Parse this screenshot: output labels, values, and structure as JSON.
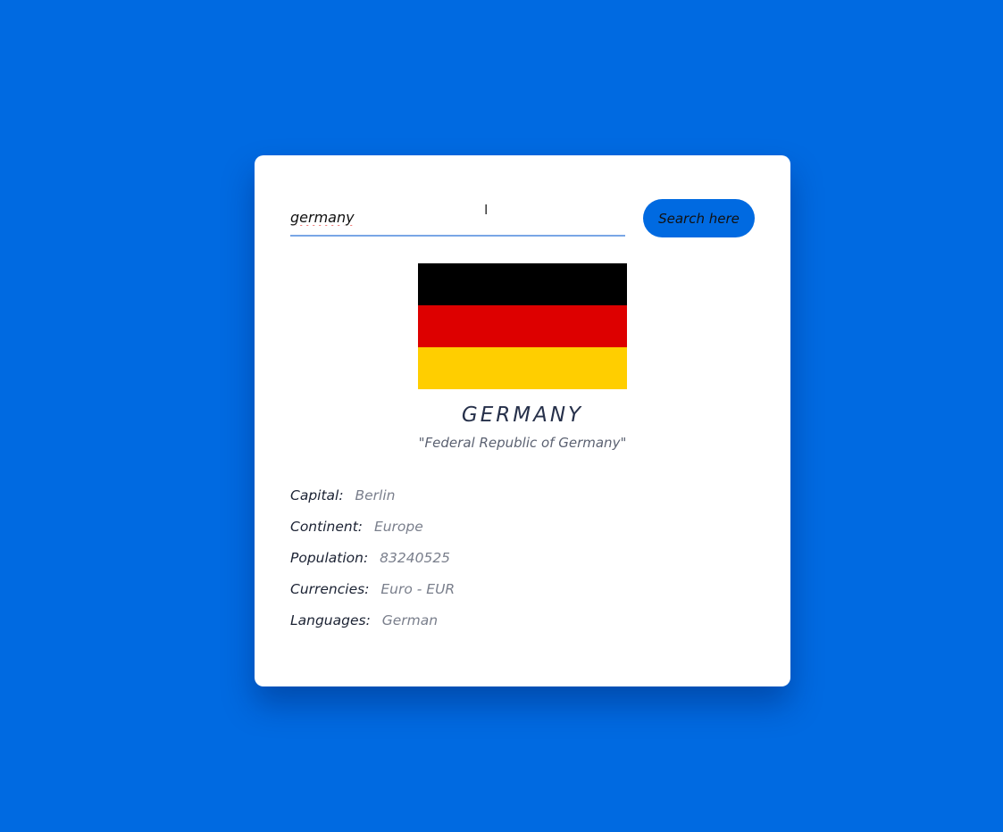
{
  "search": {
    "value": "germany",
    "button_label": "Search here"
  },
  "flag": {
    "stripes": [
      "#000000",
      "#dd0000",
      "#ffce00"
    ]
  },
  "country": {
    "name": "GERMANY",
    "official_name": "\"Federal Republic of Germany\""
  },
  "details": [
    {
      "label": "Capital:",
      "value": "Berlin"
    },
    {
      "label": "Continent:",
      "value": "Europe"
    },
    {
      "label": "Population:",
      "value": "83240525"
    },
    {
      "label": "Currencies:",
      "value": "Euro - EUR"
    },
    {
      "label": "Languages:",
      "value": "German"
    }
  ],
  "colors": {
    "background": "#006ae1",
    "card": "#ffffff",
    "button": "#006ae1"
  }
}
